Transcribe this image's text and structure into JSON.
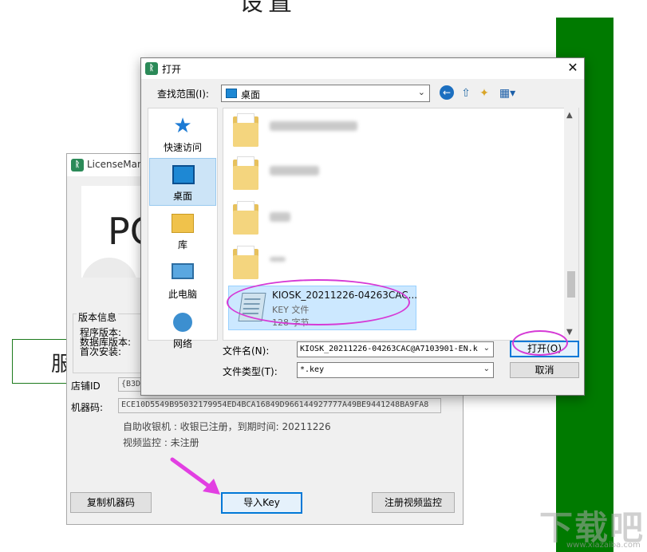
{
  "background": {
    "top_title": "设置",
    "service_box_text": "服",
    "watermark": "下载吧",
    "watermark_url": "www.xiazaiba.com"
  },
  "license_window": {
    "title": "LicenseMana",
    "banner_text": "PC",
    "version_group_label": "版本信息",
    "version_lines": [
      "程序版本:",
      "数据库版本:",
      "首次安装:"
    ],
    "store_id_label": "店铺ID",
    "store_id_value": "{B3DF",
    "machine_code_label": "机器码:",
    "machine_code_value": "ECE10D5549B95032179954ED4BCA16849D966144927777A49BE9441248BA9FA8",
    "status_lines": [
      "自助收银机 : 收银已注册，到期时间: 20211226",
      "视频监控 : 未注册"
    ],
    "buttons": {
      "copy_machine_code": "复制机器码",
      "import_key": "导入Key",
      "register_video": "注册视频监控"
    }
  },
  "open_dialog": {
    "title": "打开",
    "look_in_label": "查找范围(I):",
    "look_in_value": "桌面",
    "places": [
      {
        "label": "快速访问"
      },
      {
        "label": "桌面"
      },
      {
        "label": "库"
      },
      {
        "label": "此电脑"
      },
      {
        "label": "网络"
      }
    ],
    "selected_file": {
      "name": "KIOSK_20211226-04263CAC...",
      "type": "KEY 文件",
      "size": "128 字节"
    },
    "file_name_label": "文件名(N):",
    "file_name_value": "KIOSK_20211226-04263CAC@A7103901-EN.k",
    "file_type_label": "文件类型(T):",
    "file_type_value": "*.key",
    "open_button": "打开(O)",
    "cancel_button": "取消"
  },
  "colors": {
    "green_bar": "#007a00",
    "annotation": "#d63ad6",
    "selection": "#cce8ff"
  }
}
